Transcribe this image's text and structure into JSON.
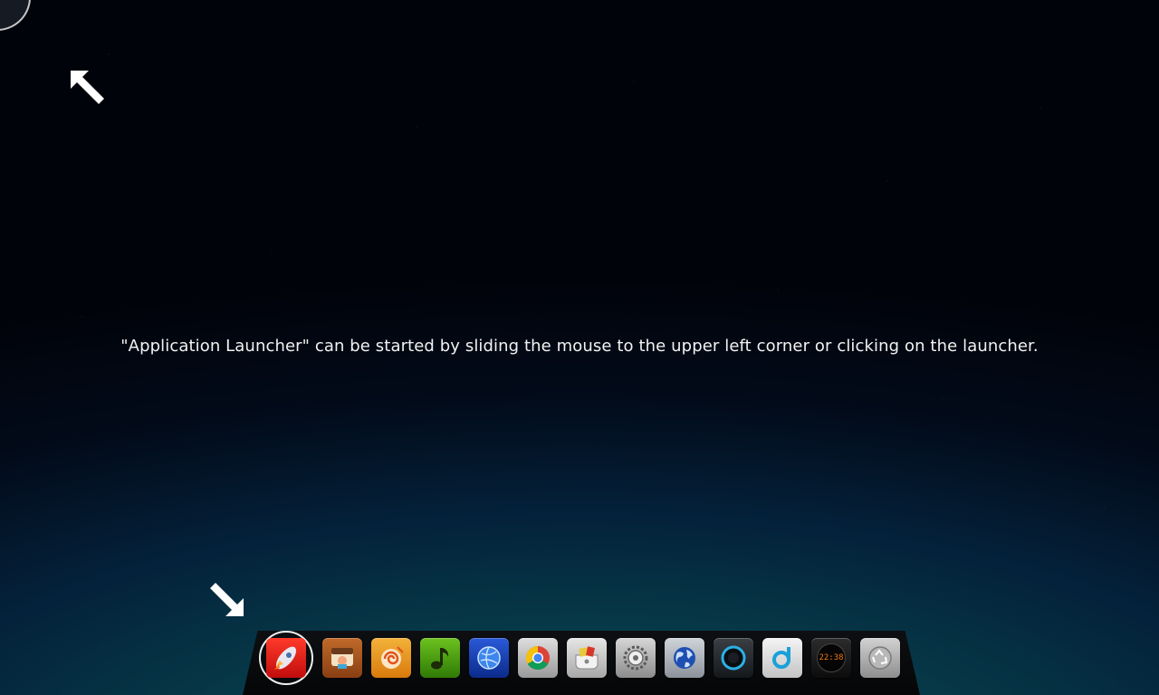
{
  "hint": {
    "text": "\"Application Launcher\" can be started by sliding the mouse to the upper left corner or clicking on the launcher."
  },
  "dock": {
    "items": [
      {
        "name": "launcher",
        "icon": "rocket-icon"
      },
      {
        "name": "file-manager",
        "icon": "file-manager-icon"
      },
      {
        "name": "software-center",
        "icon": "software-center-icon"
      },
      {
        "name": "music-player",
        "icon": "music-note-icon"
      },
      {
        "name": "browser",
        "icon": "globe-browser-icon"
      },
      {
        "name": "chrome",
        "icon": "chrome-icon"
      },
      {
        "name": "installer",
        "icon": "package-icon"
      },
      {
        "name": "settings",
        "icon": "settings-gear-icon"
      },
      {
        "name": "network",
        "icon": "earth-icon"
      },
      {
        "name": "media-player",
        "icon": "media-player-icon"
      },
      {
        "name": "music",
        "icon": "deepin-music-icon"
      },
      {
        "name": "clock",
        "icon": "clock-icon",
        "time": "22:38"
      },
      {
        "name": "trash",
        "icon": "trash-icon"
      }
    ]
  },
  "colors": {
    "launcher_red": "#e01b12",
    "clock_digits": "#f07a17"
  }
}
